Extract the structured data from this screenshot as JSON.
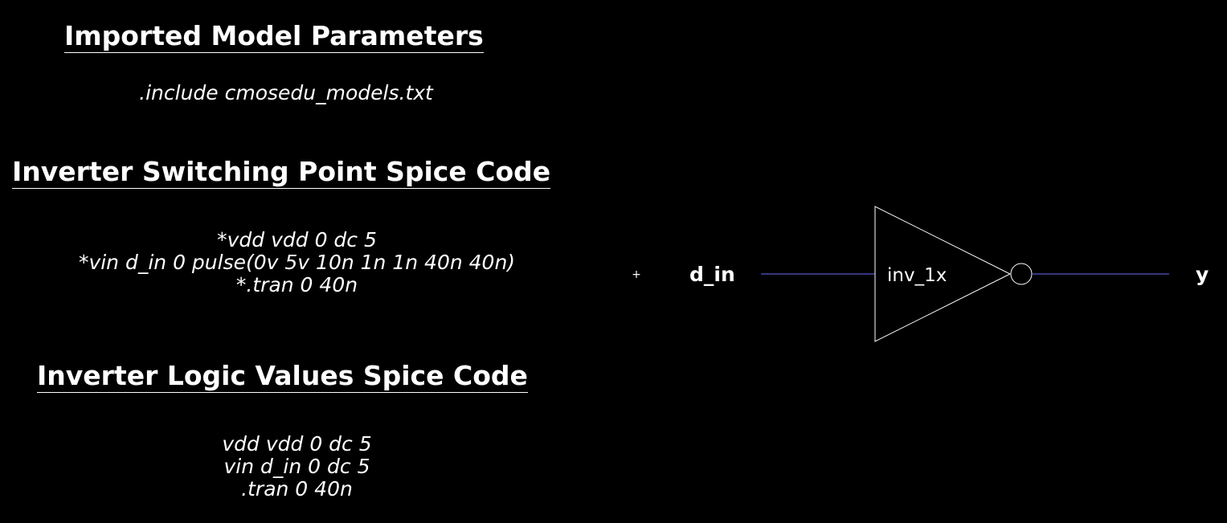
{
  "sections": [
    {
      "id": "model-params",
      "heading": "Imported Model Parameters",
      "lines": [
        ".include cmosedu_models.txt"
      ]
    },
    {
      "id": "switching-point",
      "heading": "Inverter Switching Point Spice Code",
      "lines": [
        "*vdd vdd 0 dc 5",
        "*vin d_in 0 pulse(0v 5v 10n 1n 1n 40n 40n)",
        "*.tran 0 40n"
      ]
    },
    {
      "id": "logic-values",
      "heading": "Inverter Logic Values Spice Code",
      "lines": [
        "vdd vdd 0 dc 5",
        "vin d_in 0 dc 5",
        ".tran 0 40n"
      ]
    }
  ],
  "schematic": {
    "input_pin": "d_in",
    "output_pin": "y",
    "gate_label": "inv_1x",
    "origin_marker": "+",
    "wire_color": "#6b6bff",
    "line_color": "#ffffff"
  }
}
